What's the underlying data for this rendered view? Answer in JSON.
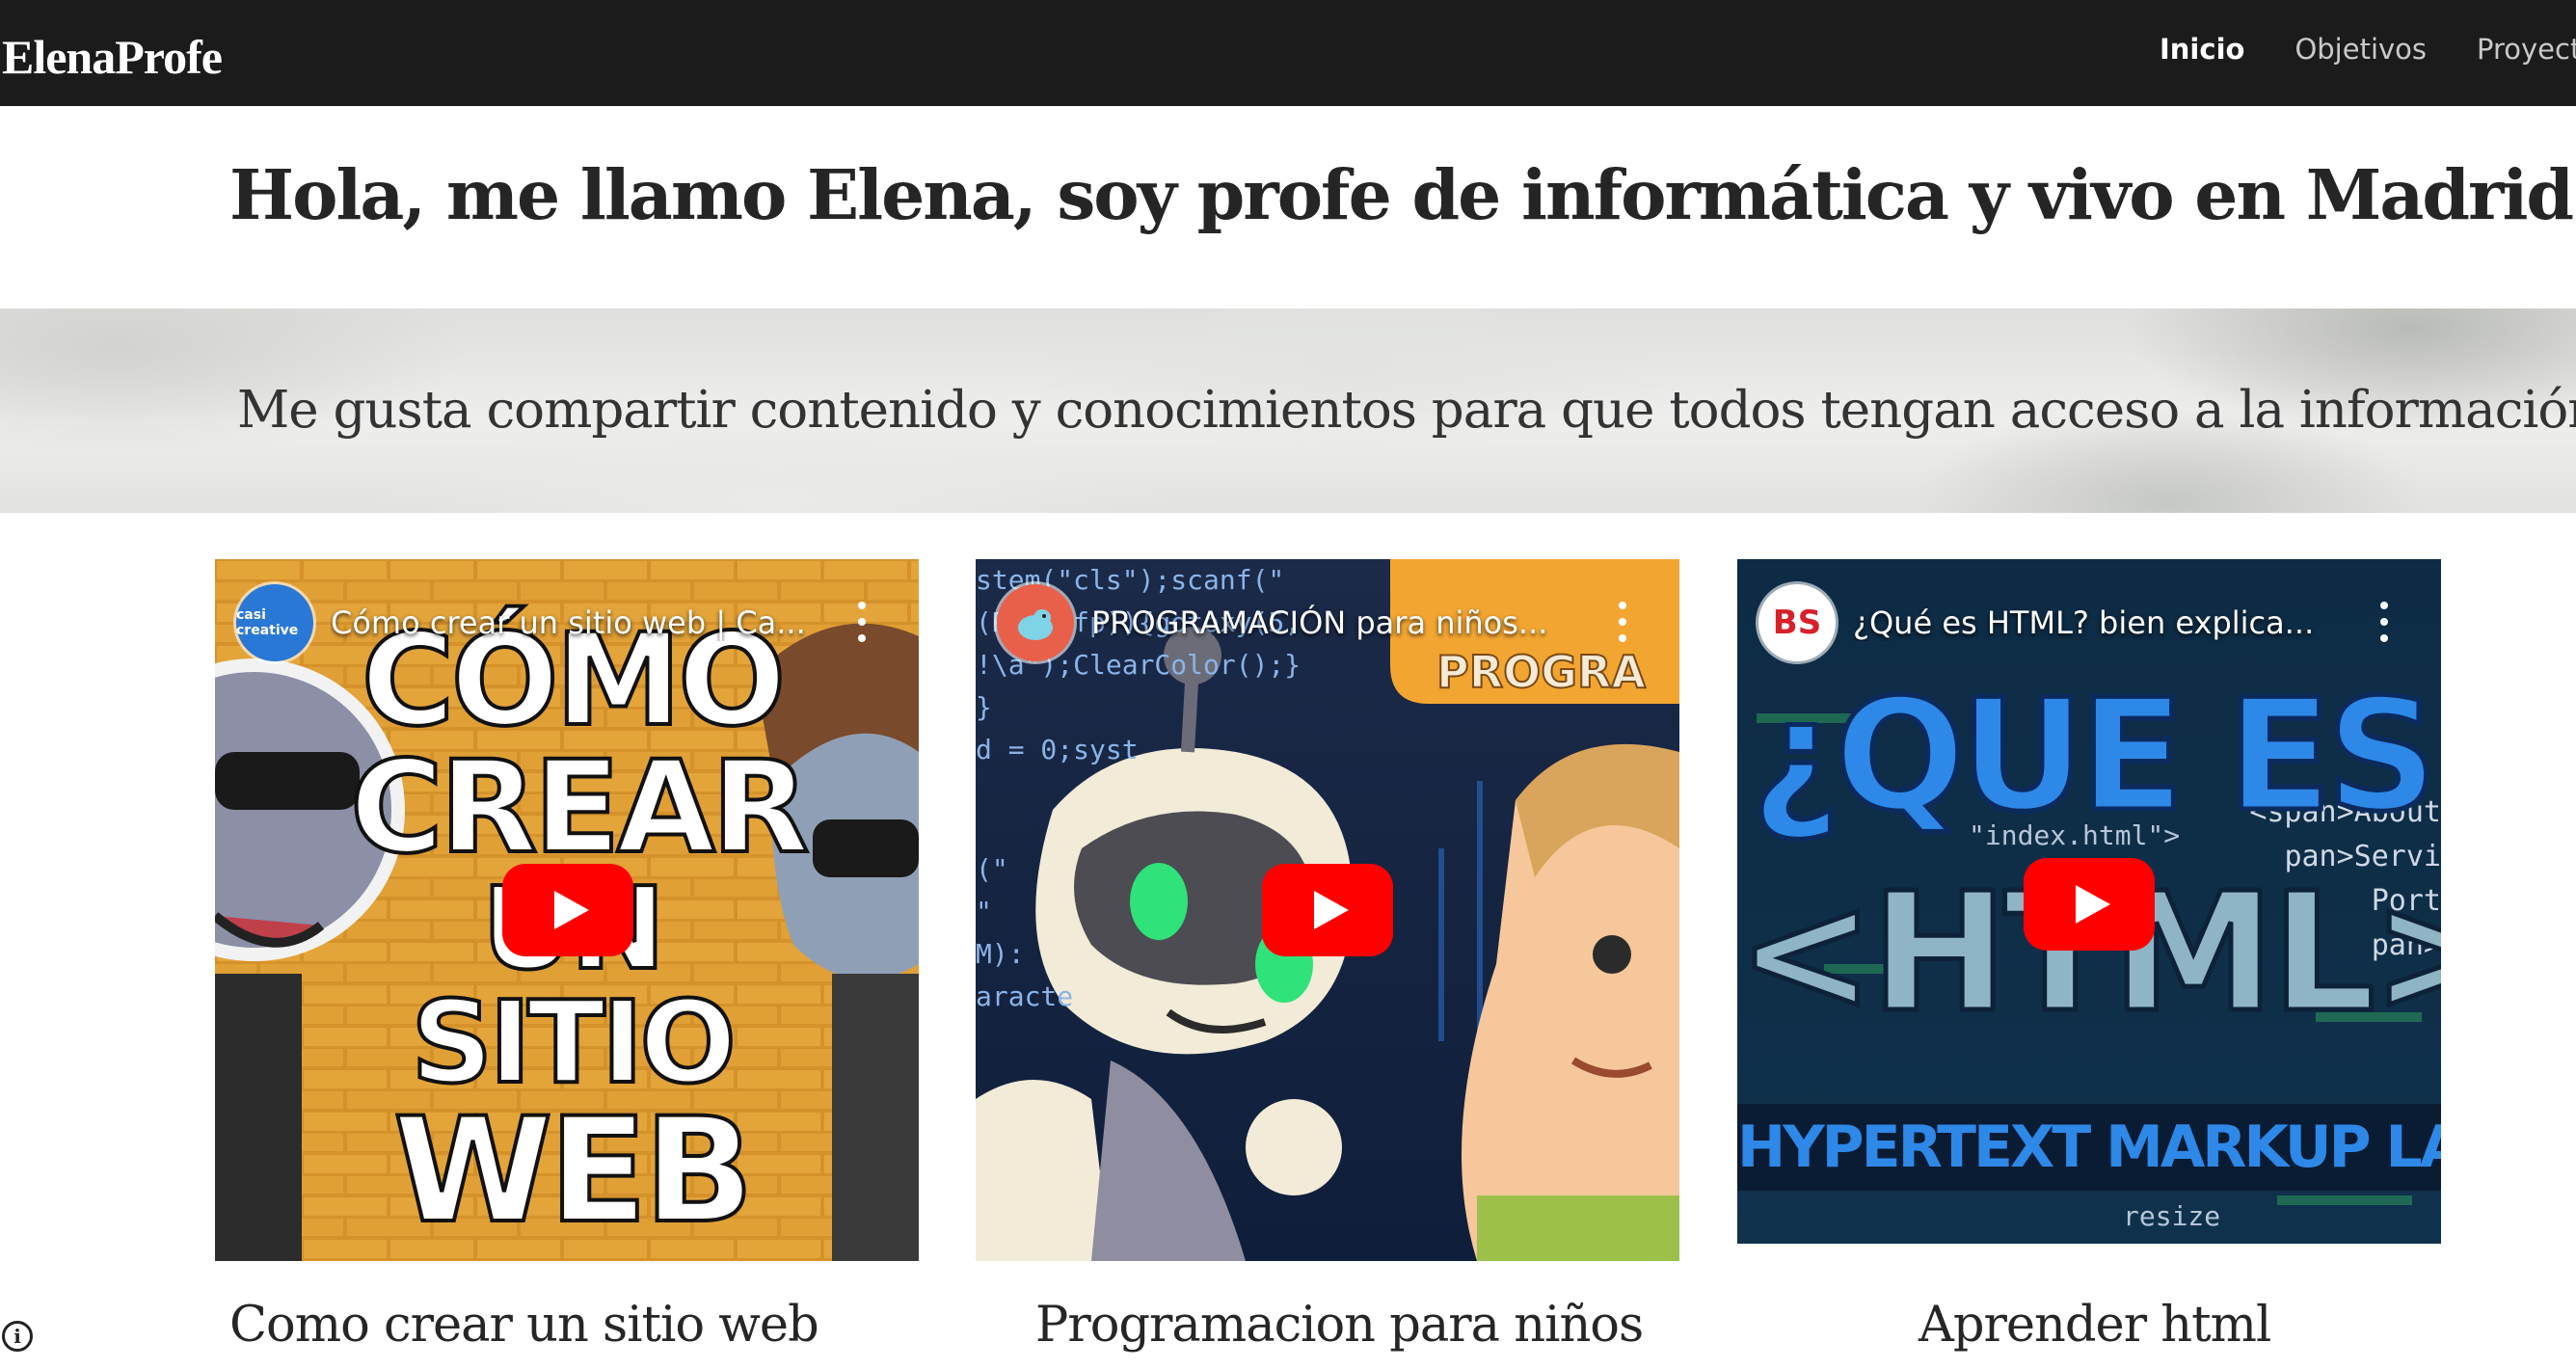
{
  "header": {
    "brand": "ElenaProfe",
    "nav": [
      {
        "label": "Inicio",
        "active": true
      },
      {
        "label": "Objetivos",
        "active": false
      },
      {
        "label": "Proyecto",
        "active": false
      }
    ]
  },
  "intro": {
    "heading": "Hola, me llamo Elena, soy  profe de informática y vivo en Madrid."
  },
  "banner": {
    "text": "Me gusta compartir contenido y conocimientos para que todos tengan acceso a la información."
  },
  "videos": [
    {
      "channel_badge": "casi creative",
      "title": "Cómo crear un sitio web | Ca...",
      "thumb_text": [
        "CÓMO",
        "CREAR",
        "UN SITIO",
        "WEB"
      ],
      "caption": "Como crear un sitio web"
    },
    {
      "channel_badge": "",
      "title": "PROGRAMACIÓN para niños...",
      "thumb_text": [
        "PROGRA"
      ],
      "code_lines": [
        "stem(\"cls\");scanf(\"",
        "(R),1,fp)){gotoxy(5,",
        "!\\a\");ClearColor();}",
        "}",
        "d = 0;syst",
        "(\"",
        "\"",
        "M):",
        "aracte"
      ],
      "caption": "Programacion para niños"
    },
    {
      "channel_badge": "BS",
      "title": "¿Qué es HTML? bien explica...",
      "thumb_text": [
        "¿QUE ES?",
        "<HTML>",
        "HYPERTEXT MARKUP LANGUAGE"
      ],
      "code_lines": [
        "\"index.html\">",
        "<span>About",
        "pan>Servi",
        "Port",
        "pan>",
        "resize"
      ],
      "caption": "Aprender html"
    }
  ],
  "colors": {
    "topbar": "#1b1b1b",
    "play": "#ff0000",
    "html_blue": "#1c6fc9"
  },
  "icons": [
    "play-icon",
    "more-vert-icon",
    "info-icon"
  ]
}
